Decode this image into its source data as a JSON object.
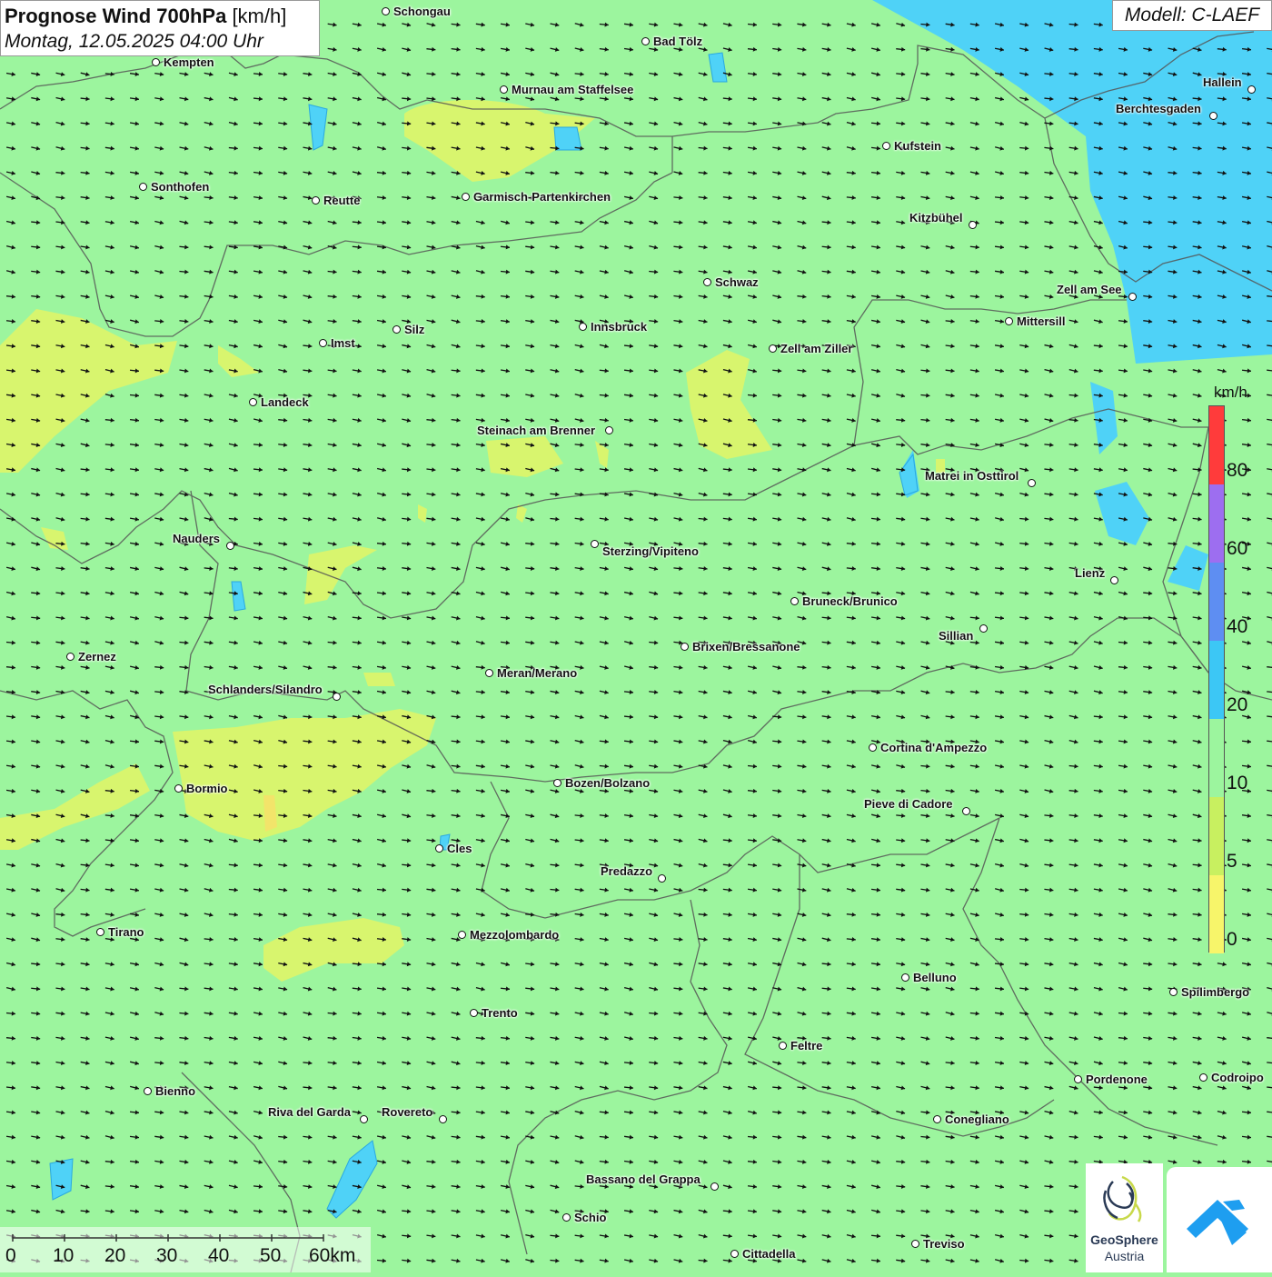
{
  "header": {
    "title_bold": "Prognose Wind 700hPa",
    "title_unit": "[km/h]",
    "datetime": "Montag, 12.05.2025 04:00 Uhr"
  },
  "model": {
    "label": "Modell: C-LAEF"
  },
  "legend": {
    "unit": "km/h",
    "ticks": [
      "80",
      "60",
      "40",
      "20",
      "10",
      "5",
      "0"
    ],
    "colors": [
      "#ff3b3b",
      "#9d6ef0",
      "#5e8ef2",
      "#3cc7f5",
      "#9cf59e",
      "#c8f060",
      "#f7f56a"
    ]
  },
  "scalebar": {
    "labels": [
      "0",
      "10",
      "20",
      "30",
      "40",
      "50",
      "60km"
    ]
  },
  "logos": {
    "geosphere_line1": "GeoSphere",
    "geosphere_line2": "Austria"
  },
  "colors": {
    "background_wind": "#9cf59e",
    "calm_yellow": "#d8f56e",
    "strong_blue": "#4fd2f7",
    "arrow": "#111111"
  },
  "wind": {
    "dominant_direction": "west-to-east, slightly southeast"
  },
  "cities": [
    "Schongau",
    "Bad Tölz",
    "Kempten",
    "Murnau am Staffelsee",
    "Hallein",
    "Berchtesgaden",
    "Kufstein",
    "Sonthofen",
    "Reutte",
    "Garmisch-Partenkirchen",
    "Kitzbühel",
    "Schwaz",
    "Zell am See",
    "Mittersill",
    "Innsbruck",
    "Silz",
    "Imst",
    "Zell am Ziller",
    "Landeck",
    "Steinach am Brenner",
    "Matrei in Osttirol",
    "Nauders",
    "Sterzing/Vipiteno",
    "Lienz",
    "Bruneck/Brunico",
    "Sillian",
    "Zernez",
    "Brixen/Bressanone",
    "Meran/Merano",
    "Schlanders/Silandro",
    "Cortina d'Ampezzo",
    "Bozen/Bolzano",
    "Bormio",
    "Pieve di Cadore",
    "Cles",
    "Predazzo",
    "Tirano",
    "Mezzolombardo",
    "Belluno",
    "Spilimbergo",
    "Trento",
    "Feltre",
    "Bienno",
    "Pordenone",
    "Codroipo",
    "Riva del Garda",
    "Rovereto",
    "Conegliano",
    "Bassano del Grappa",
    "Schio",
    "Treviso",
    "Cittadella"
  ]
}
